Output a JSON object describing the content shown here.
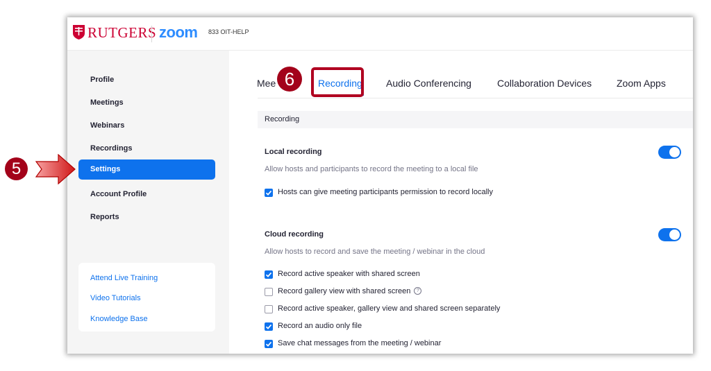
{
  "header": {
    "brand_university": "RUTGERS",
    "brand_app": "zoom",
    "help_phone": "833 OIT-HELP"
  },
  "sidebar": {
    "items": [
      {
        "label": "Profile"
      },
      {
        "label": "Meetings"
      },
      {
        "label": "Webinars"
      },
      {
        "label": "Recordings"
      },
      {
        "label": "Settings"
      },
      {
        "label": "Account Profile"
      },
      {
        "label": "Reports"
      }
    ],
    "active_item": "Settings",
    "links": [
      {
        "label": "Attend Live Training"
      },
      {
        "label": "Video Tutorials"
      },
      {
        "label": "Knowledge Base"
      }
    ]
  },
  "tabs": [
    {
      "label": "Mee"
    },
    {
      "label": "Recording"
    },
    {
      "label": "Audio Conferencing"
    },
    {
      "label": "Collaboration Devices"
    },
    {
      "label": "Zoom Apps"
    }
  ],
  "active_tab": "Recording",
  "section": {
    "title": "Recording"
  },
  "local_recording": {
    "title": "Local recording",
    "description": "Allow hosts and participants to record the meeting to a local file",
    "enabled": true,
    "options": [
      {
        "label": "Hosts can give meeting participants permission to record locally",
        "checked": true
      }
    ]
  },
  "cloud_recording": {
    "title": "Cloud recording",
    "description": "Allow hosts to record and save the meeting / webinar in the cloud",
    "enabled": true,
    "options": [
      {
        "label": "Record active speaker with shared screen",
        "checked": true
      },
      {
        "label": "Record gallery view with shared screen",
        "checked": false,
        "help_icon": "?"
      },
      {
        "label": "Record active speaker, gallery view and shared screen separately",
        "checked": false
      },
      {
        "label": "Record an audio only file",
        "checked": true
      },
      {
        "label": "Save chat messages from the meeting / webinar",
        "checked": true
      }
    ]
  },
  "annotations": {
    "step5": "5",
    "step6": "6",
    "accent_color": "#a3021a"
  },
  "colors": {
    "accent": "#0e72ed",
    "rutgers_red": "#cc0033",
    "zoom_blue": "#2d8cff"
  }
}
